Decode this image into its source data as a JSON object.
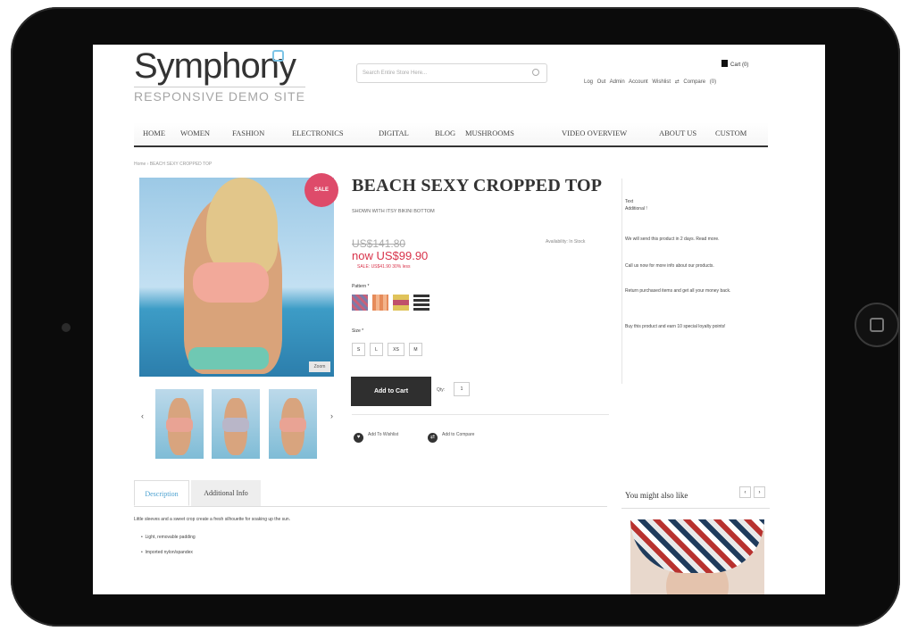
{
  "site": {
    "logo": "Symphony",
    "tagline": "RESPONSIVE DEMO SITE",
    "search_placeholder": "Search Entire Store Here...",
    "cart": "Cart (0)",
    "top_links": "Log Out  Admin  Account  Wishlist",
    "compare": "Compare (0)"
  },
  "nav": [
    {
      "label": "HOME"
    },
    {
      "label": "WOMEN"
    },
    {
      "label": "FASHION"
    },
    {
      "label": "ELECTRONICS"
    },
    {
      "label": "DIGITAL"
    },
    {
      "label": "BLOG"
    },
    {
      "label": "MUSHROOMS"
    },
    {
      "label": "VIDEO OVERVIEW"
    },
    {
      "label": "ABOUT US"
    },
    {
      "label": "CUSTOM"
    }
  ],
  "breadcrumb": "Home › BEACH SEXY CROPPED TOP",
  "product": {
    "sale_badge": "SALE",
    "zoom": "Zoom",
    "title": "BEACH SEXY CROPPED TOP",
    "subtitle": "SHOWN WITH ITSY BIKINI BOTTOM",
    "old_price": "US$141.80",
    "new_price": "now US$99.90",
    "save_info": "SALE: US$41.90 30% less",
    "availability": "Availability: In Stock",
    "pattern_label": "Pattern *",
    "size_label": "Size *",
    "sizes": [
      "S",
      "L",
      "XS",
      "M"
    ],
    "add_to_cart": "Add to Cart",
    "qty_label": "Qty:",
    "qty_value": "1",
    "wishlist": "Add To Wishlist",
    "compare": "Add to Compare"
  },
  "swatch_colors": [
    "#7e7aa6",
    "#e68b5a",
    "#e0c35a",
    "#333333"
  ],
  "right_sidebar": {
    "line1": "Text",
    "line2": "Additional !",
    "line3": "We will send this product in 2 days. Read more.",
    "line4": "Call us now for more info about our products.",
    "line5": "Return purchased items and get all your money back.",
    "line6": "Buy this product and earn 10 special loyalty points!"
  },
  "tabs": [
    {
      "label": "Description"
    },
    {
      "label": "Additional Info"
    }
  ],
  "description": {
    "text": "Little sleeves and a sweet crop create a fresh silhouette for soaking up the sun.",
    "bullets": [
      "Light, removable padding",
      "Imported nylon/spandex"
    ]
  },
  "you_might": {
    "title": "You might also like",
    "prev": "‹",
    "next": "›"
  },
  "arrows": {
    "left": "‹",
    "right": "›"
  }
}
